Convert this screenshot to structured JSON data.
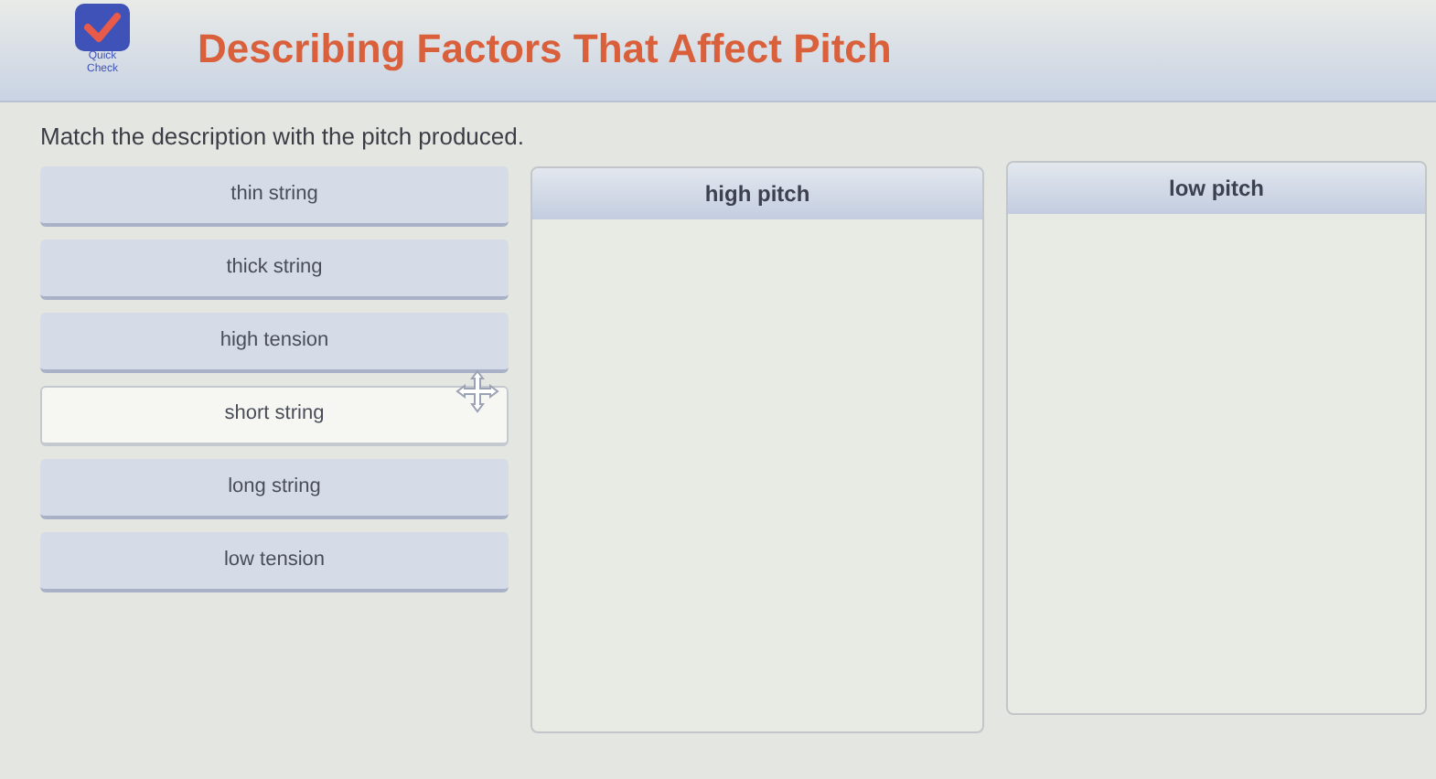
{
  "header": {
    "badge": "Quick Check",
    "title": "Describing Factors That Affect Pitch"
  },
  "instruction": "Match the description with the pitch produced.",
  "tiles": [
    {
      "label": "thin string",
      "selected": false
    },
    {
      "label": "thick string",
      "selected": false
    },
    {
      "label": "high tension",
      "selected": false
    },
    {
      "label": "short string",
      "selected": true
    },
    {
      "label": "long string",
      "selected": false
    },
    {
      "label": "low tension",
      "selected": false
    }
  ],
  "targets": [
    {
      "label": "high pitch"
    },
    {
      "label": "low pitch"
    }
  ]
}
